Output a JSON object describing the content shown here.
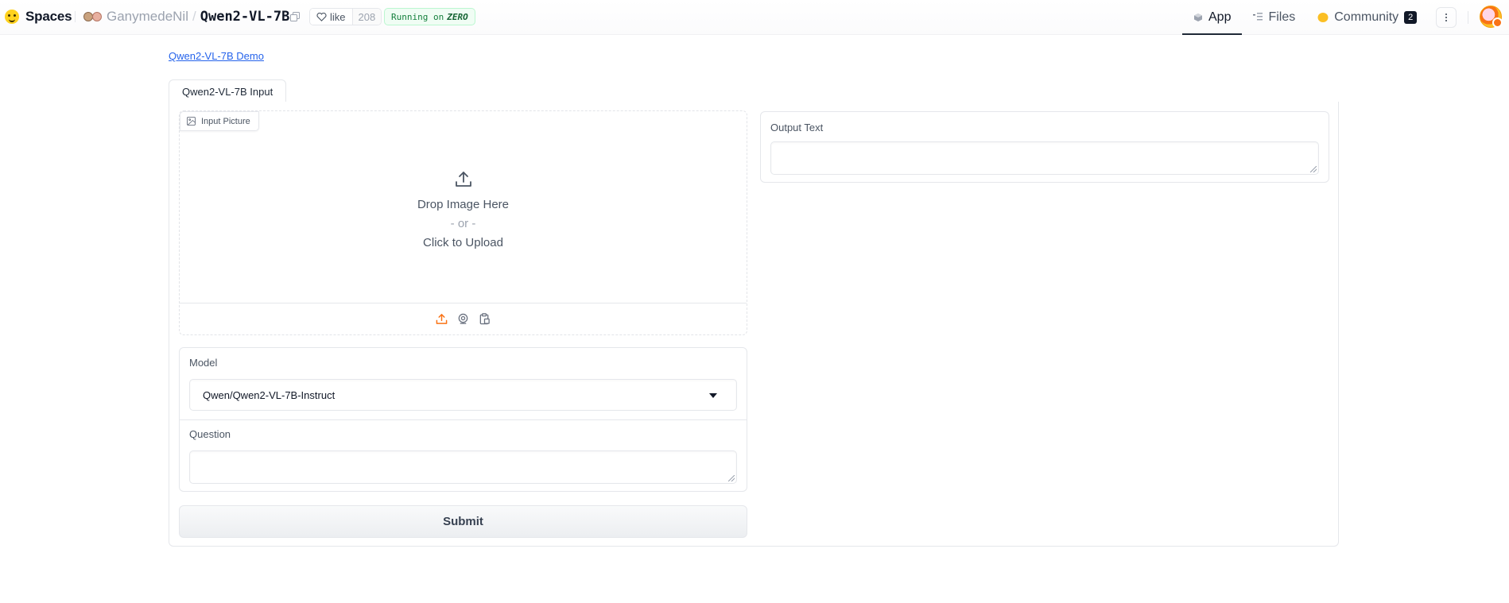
{
  "header": {
    "brand": "Spaces",
    "owner": "GanymedeNil",
    "separator": "/",
    "repo": "Qwen2-VL-7B",
    "like_label": "like",
    "like_count": "208",
    "running_prefix": "Running on",
    "running_hardware": "ZERO",
    "nav": {
      "app": "App",
      "files": "Files",
      "community": "Community",
      "community_count": "2"
    }
  },
  "app": {
    "title_link": "Qwen2-VL-7B Demo",
    "tab_label": "Qwen2-VL-7B Input",
    "upload": {
      "label": "Input Picture",
      "drop_text": "Drop Image Here",
      "or_text": "- or -",
      "click_text": "Click to Upload",
      "tools": [
        "upload-icon",
        "webcam-icon",
        "clipboard-icon"
      ]
    },
    "model": {
      "label": "Model",
      "selected": "Qwen/Qwen2-VL-7B-Instruct"
    },
    "question": {
      "label": "Question",
      "value": ""
    },
    "submit_label": "Submit",
    "output": {
      "label": "Output Text",
      "value": ""
    }
  },
  "colors": {
    "accent": "#f97316",
    "link": "#2563eb",
    "running_text": "#15803d",
    "border": "#e5e7eb"
  }
}
